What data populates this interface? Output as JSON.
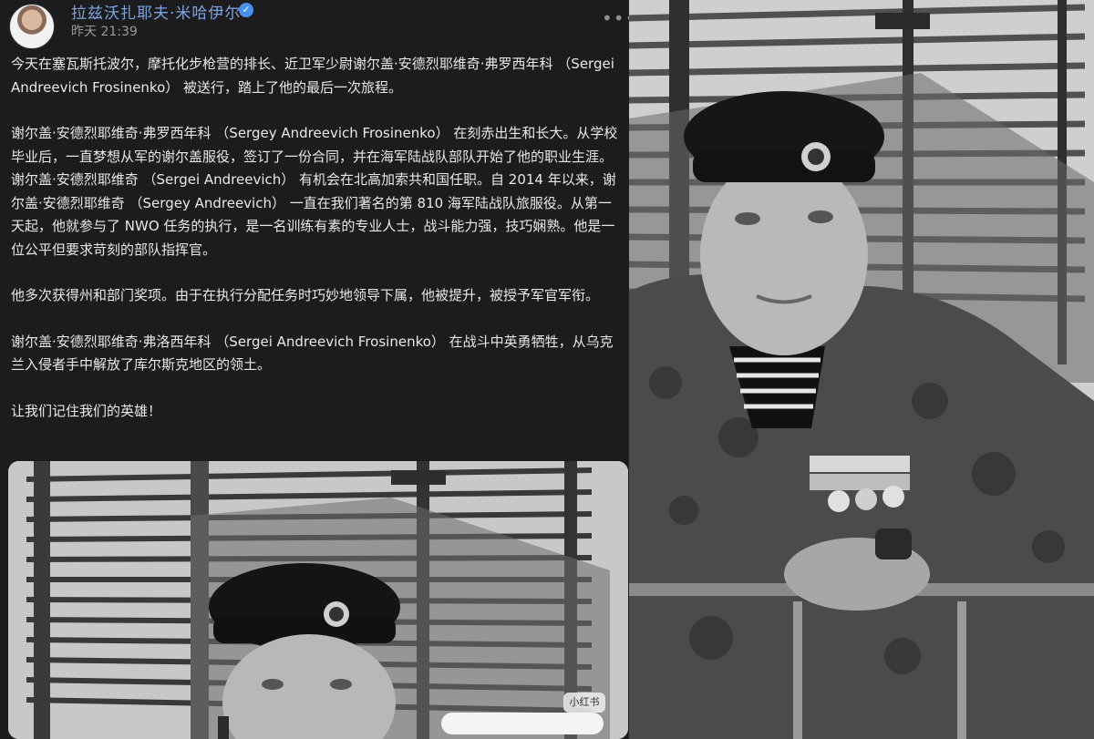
{
  "post": {
    "author_name": "拉兹沃扎耶夫·米哈伊尔",
    "time": "昨天 21:39",
    "paragraphs": [
      "今天在塞瓦斯托波尔，摩托化步枪营的排长、近卫军少尉谢尔盖·安德烈耶维奇·弗罗西年科 （Sergei Andreevich Frosinenko） 被送行，踏上了他的最后一次旅程。",
      "谢尔盖·安德烈耶维奇·弗罗西年科 （Sergey Andreevich Frosinenko） 在刻赤出生和长大。从学校毕业后，一直梦想从军的谢尔盖服役，签订了一份合同，并在海军陆战队部队开始了他的职业生涯。谢尔盖·安德烈耶维奇 （Sergei Andreevich） 有机会在北高加索共和国任职。自 2014 年以来，谢尔盖·安德烈耶维奇 （Sergey Andreevich） 一直在我们著名的第 810 海军陆战队旅服役。从第一天起，他就参与了 NWO 任务的执行，是一名训练有素的专业人士，战斗能力强，技巧娴熟。他是一位公平但要求苛刻的部队指挥官。",
      "他多次获得州和部门奖项。由于在执行分配任务时巧妙地领导下属，他被提升，被授予军官军衔。",
      "谢尔盖·安德烈耶维奇·弗洛西年科 （Sergei Andreevich Frosinenko） 在战斗中英勇牺牲，从乌克兰入侵者手中解放了库尔斯克地区的领土。",
      "让我们记住我们的英雄！"
    ],
    "watermark": "小红书"
  },
  "icons": {
    "verified": "verified-check-icon",
    "more": "more-dots-icon"
  },
  "colors": {
    "background": "#1c1c1e",
    "author_name": "#7da4e0",
    "text": "#e9e9ea",
    "verified_badge": "#4a8ef0"
  }
}
